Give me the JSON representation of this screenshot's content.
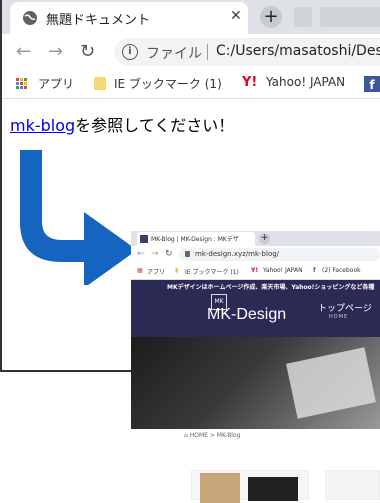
{
  "outer": {
    "tab_title": "無題ドキュメント",
    "tab_close": "✕",
    "new_tab": "+",
    "omnibox": {
      "label": "ファイル",
      "url": "C:/Users/masatoshi/Des"
    },
    "bookmarks": {
      "apps": "アプリ",
      "ie": "IE ブックマーク (1)",
      "yahoo": "Yahoo! JAPAN"
    }
  },
  "content": {
    "link_text": "mk-blog",
    "body_text": "を参照してください！"
  },
  "inner": {
    "tab_title": "MK-Blog | MK-Design : MKデザ",
    "url": "mk-design.xyz/mk-blog/",
    "bookmarks": {
      "apps": "アプリ",
      "ie": "IE ブックマーク (1)",
      "yahoo": "Yahoo! JAPAN",
      "facebook": "(2) Facebook"
    },
    "banner": "MKデザインはホームページ作成、楽天市場、Yahoo!ショッピングなど各種",
    "logo": "MK-Design",
    "logo_mark": "MK",
    "nav_top": "トップページ",
    "nav_home": "HOME",
    "breadcrumb": "HOME > MK-Blog"
  },
  "colors": {
    "arrow": "#1565c0",
    "link": "#0000ee",
    "site_header": "#2a2a55"
  }
}
